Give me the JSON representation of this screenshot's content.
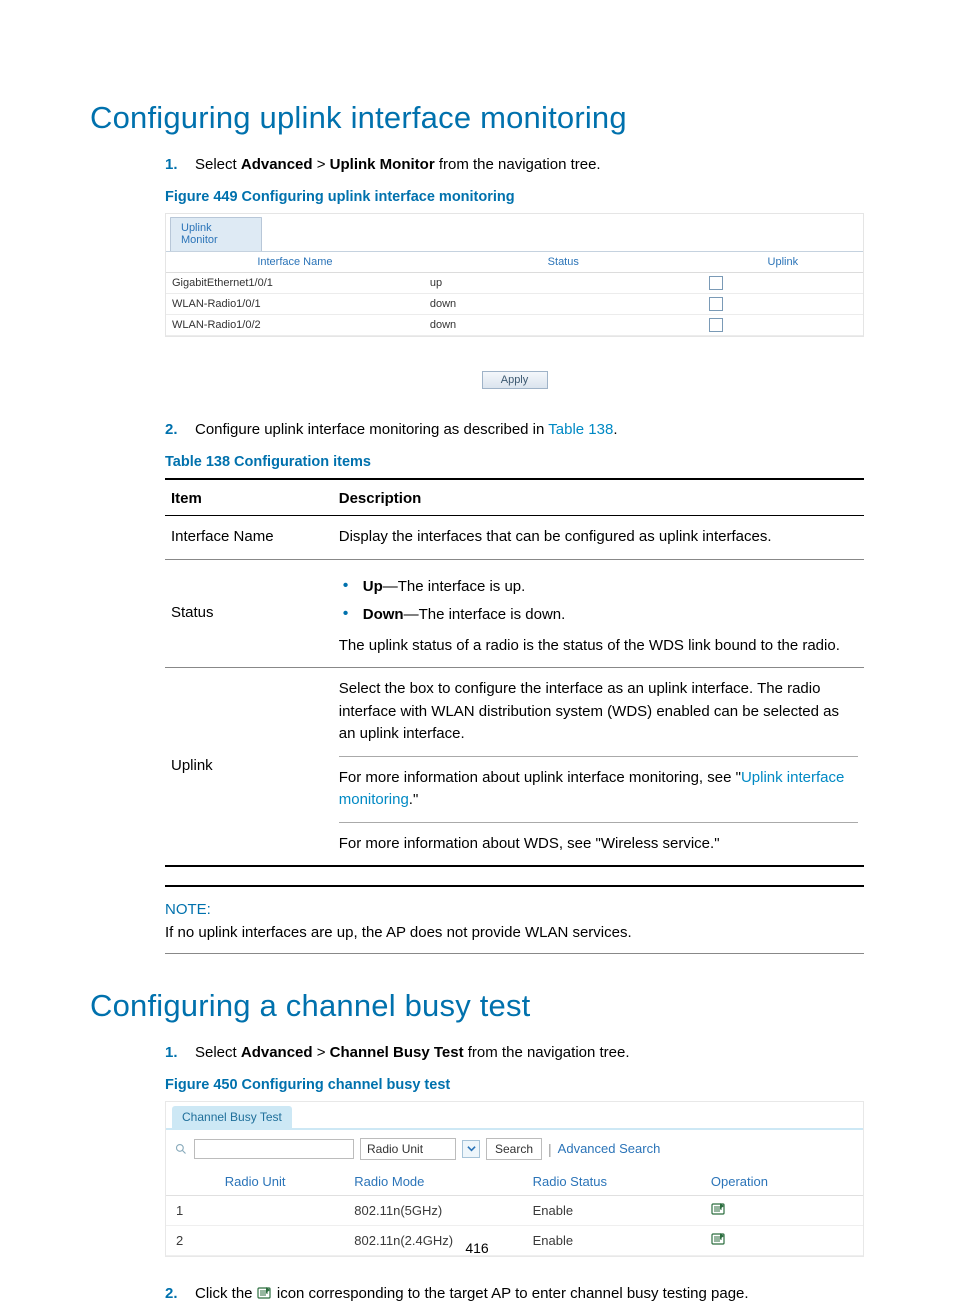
{
  "headings": {
    "uplink": "Configuring uplink interface monitoring",
    "channel": "Configuring a channel busy test"
  },
  "step_uplink_1": {
    "pre": "Select ",
    "b1": "Advanced",
    "gt": " > ",
    "b2": "Uplink Monitor",
    "post": " from the navigation tree."
  },
  "fig449_caption": "Figure 449 Configuring uplink interface monitoring",
  "fig449": {
    "tab": "Uplink Monitor",
    "cols": {
      "c0": "Interface Name",
      "c1": "Status",
      "c2": "Uplink"
    },
    "rows": [
      {
        "name": "GigabitEthernet1/0/1",
        "status": "up"
      },
      {
        "name": "WLAN-Radio1/0/1",
        "status": "down"
      },
      {
        "name": "WLAN-Radio1/0/2",
        "status": "down"
      }
    ],
    "apply": "Apply"
  },
  "step_uplink_2": {
    "pre": "Configure uplink interface monitoring as described in ",
    "link": "Table 138",
    "post": "."
  },
  "table138_caption": "Table 138 Configuration items",
  "table138": {
    "cols": {
      "c0": "Item",
      "c1": "Description"
    },
    "r0": {
      "item": "Interface Name",
      "desc": "Display the interfaces that can be configured as uplink interfaces."
    },
    "r1": {
      "item": "Status",
      "b0lbl": "Up",
      "b0txt": "—The interface is up.",
      "b1lbl": "Down",
      "b1txt": "—The interface is down.",
      "tail": "The uplink status of a radio is the status of the WDS link bound to the radio."
    },
    "r2": {
      "item": "Uplink",
      "p1": "Select the box to configure the interface as an uplink interface. The radio interface with WLAN distribution system (WDS) enabled can be selected as an uplink interface.",
      "p2a": "For more information about uplink interface monitoring, see \"",
      "p2link": "Uplink interface monitoring",
      "p2b": ".\"",
      "p3": "For more information about WDS, see \"Wireless service.\""
    }
  },
  "note": {
    "label": "NOTE:",
    "body": "If no uplink interfaces are up, the AP does not provide WLAN services."
  },
  "step_channel_1": {
    "pre": "Select ",
    "b1": "Advanced",
    "gt": " > ",
    "b2": "Channel Busy Test",
    "post": " from the navigation tree."
  },
  "fig450_caption": "Figure 450 Configuring channel busy test",
  "fig450": {
    "tab": "Channel Busy Test",
    "select": "Radio Unit",
    "search_btn": "Search",
    "adv": "Advanced Search",
    "cols": {
      "c0": "Radio Unit",
      "c1": "Radio Mode",
      "c2": "Radio Status",
      "c3": "Operation"
    },
    "rows": [
      {
        "unit": "1",
        "mode": "802.11n(5GHz)",
        "status": "Enable"
      },
      {
        "unit": "2",
        "mode": "802.11n(2.4GHz)",
        "status": "Enable"
      }
    ]
  },
  "step_channel_2": {
    "pre": "Click the ",
    "post": " icon corresponding to the target AP to enter channel busy testing page."
  },
  "page_number": "416"
}
